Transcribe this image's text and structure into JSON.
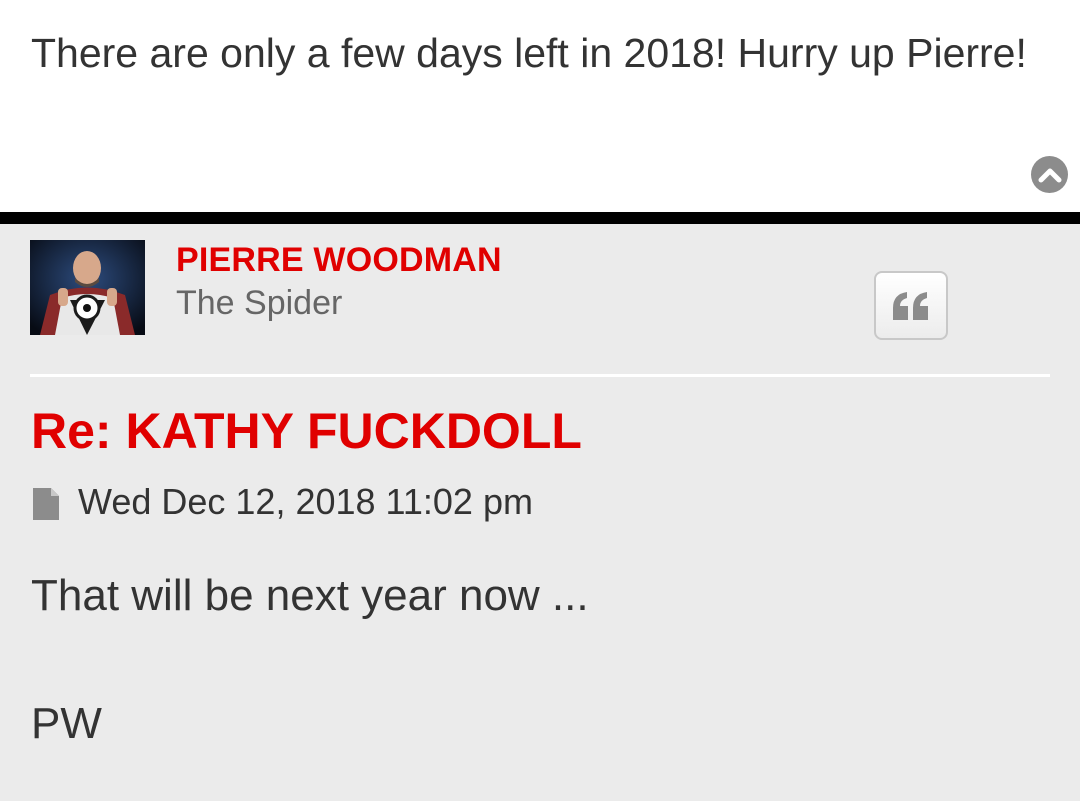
{
  "previous_post": {
    "text": "There are only a few days left in 2018! Hurry up Pierre!"
  },
  "icons": {
    "back_to_top": "chevron-up-circle-icon",
    "quote": "quote-icon",
    "post_file": "file-icon"
  },
  "post": {
    "author": "PIERRE WOODMAN",
    "rank": "The Spider",
    "title": "Re: KATHY FUCKDOLL",
    "date": "Wed Dec 12, 2018 11:02 pm",
    "body_line_1": "That will be next year now ...",
    "body_line_2": "PW"
  },
  "colors": {
    "accent_red": "#e00000",
    "post_background": "#ebebeb",
    "divider": "#000000"
  }
}
